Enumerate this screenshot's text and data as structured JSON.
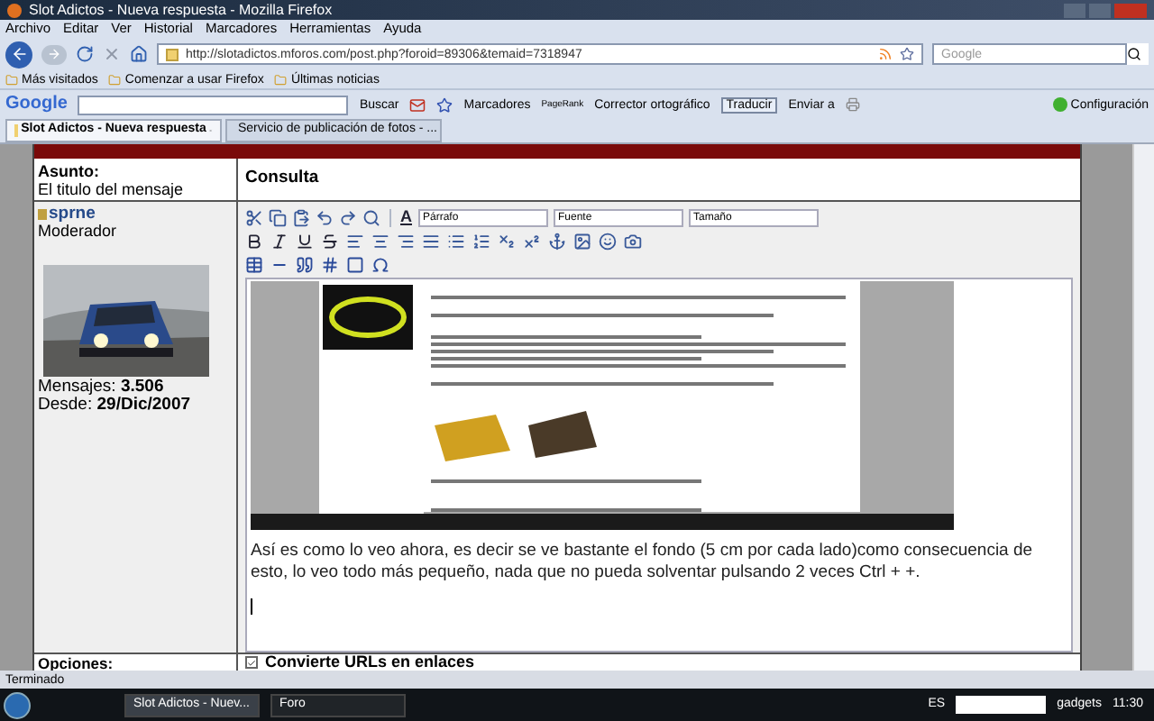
{
  "window": {
    "title": "Slot Adictos - Nueva respuesta - Mozilla Firefox"
  },
  "menu": [
    "Archivo",
    "Editar",
    "Ver",
    "Historial",
    "Marcadores",
    "Herramientas",
    "Ayuda"
  ],
  "address_bar": {
    "url": "http://slotadictos.mforos.com/post.php?foroid=89306&temaid=7318947"
  },
  "search": {
    "placeholder": "Google"
  },
  "bookmarks": [
    "Más visitados",
    "Comenzar a usar Firefox",
    "Últimas noticias"
  ],
  "google_toolbar": {
    "logo": "Google",
    "buscar": "Buscar",
    "marcadores": "Marcadores",
    "pagerank": "PageRank",
    "corrector": "Corrector ortográfico",
    "traducir": "Traducir",
    "enviar": "Enviar a",
    "settings": "Configuración"
  },
  "tabs": [
    {
      "label": "Slot Adictos - Nueva respuesta",
      "selected": true
    },
    {
      "label": "Servicio de publicación de fotos - ...",
      "selected": false
    }
  ],
  "form": {
    "subject_label": "Asunto:",
    "subject_hint": "El titulo del mensaje",
    "subject_value": "Consulta",
    "user": {
      "name": "sprne",
      "role": "Moderador",
      "posts_label": "Mensajes:",
      "posts": "3.506",
      "since_label": "Desde:",
      "since": "29/Dic/2007"
    },
    "font_color_glyph": "A",
    "format_selects": [
      "Párrafo",
      "Fuente",
      "Tamaño"
    ],
    "body": "Así es como lo veo ahora, es decir se ve bastante el fondo (5 cm por cada lado)como consecuencia de esto, lo veo todo más pequeño, nada que no pueda solventar pulsando 2 veces Ctrl + +.",
    "options_label": "Opciones:",
    "options": [
      {
        "label": "Convierte URLs en enlaces",
        "checked": true
      }
    ]
  },
  "status_bar": "Terminado",
  "taskbar": {
    "tasks": [
      {
        "label": "Slot Adictos - Nuev...",
        "selected": true
      },
      {
        "label": "Foro",
        "selected": false
      }
    ],
    "language": "ES",
    "gadgets": "gadgets",
    "clock": "11:30"
  }
}
